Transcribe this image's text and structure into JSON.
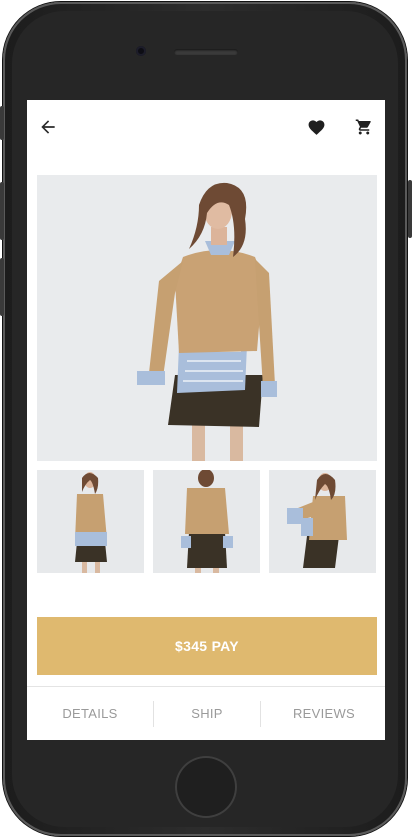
{
  "header": {
    "back_icon": "arrow-left-icon",
    "favorite_icon": "heart-icon",
    "cart_icon": "cart-icon"
  },
  "product": {
    "main_image": "woman-in-tan-sweater-striped-shirt-skirt",
    "thumbnails": [
      "front-view",
      "back-view",
      "side-view"
    ]
  },
  "pay_button": {
    "label": "$345 PAY"
  },
  "tabs": [
    {
      "label": "DETAILS"
    },
    {
      "label": "SHIP"
    },
    {
      "label": "REVIEWS"
    }
  ],
  "colors": {
    "accent": "#dfb96f",
    "tab_text": "#9a9a9a",
    "phone_body": "#262626"
  }
}
